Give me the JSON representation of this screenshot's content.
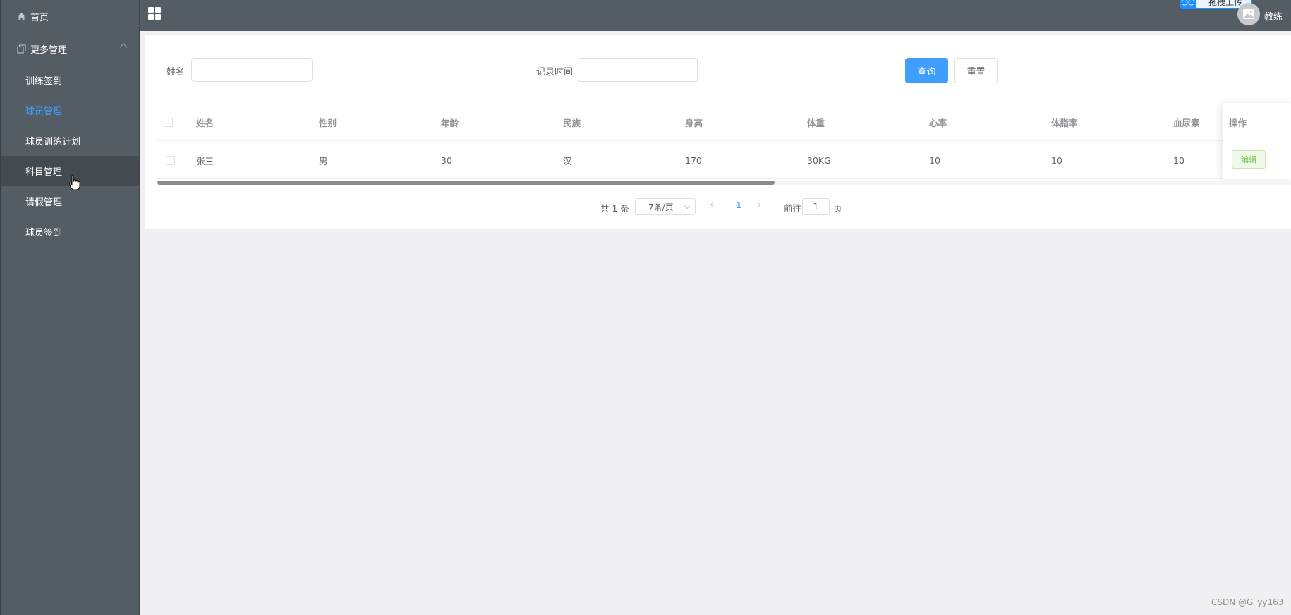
{
  "sidebar": {
    "home": "首页",
    "more": "更多管理",
    "items": [
      {
        "label": "训练签到",
        "state": "normal"
      },
      {
        "label": "球员管理",
        "state": "active"
      },
      {
        "label": "球员训练计划",
        "state": "normal"
      },
      {
        "label": "科目管理",
        "state": "hover"
      },
      {
        "label": "请假管理",
        "state": "normal"
      },
      {
        "label": "球员签到",
        "state": "normal"
      }
    ]
  },
  "header": {
    "upload_badge": "拖拽上传",
    "user_name": "教练"
  },
  "search": {
    "name_label": "姓名",
    "name_value": "",
    "time_label": "记录时间",
    "time_value": "",
    "query_button": "查询",
    "reset_button": "重置"
  },
  "table": {
    "columns": [
      "姓名",
      "性别",
      "年龄",
      "民族",
      "身高",
      "体重",
      "心率",
      "体脂率",
      "血尿素"
    ],
    "action_column": "操作",
    "rows": [
      {
        "cells": [
          "张三",
          "男",
          "30",
          "汉",
          "170",
          "30KG",
          "10",
          "10",
          "10"
        ],
        "action": "编辑"
      }
    ]
  },
  "pagination": {
    "total": "共 1 条",
    "page_size": "7条/页",
    "current_page": "1",
    "goto_prefix": "前往",
    "goto_value": "1",
    "goto_suffix": "页"
  },
  "watermark": "CSDN @G_yy163",
  "colors": {
    "sidebar_bg": "#545c64",
    "primary": "#409eff",
    "success": "#67c23a"
  }
}
